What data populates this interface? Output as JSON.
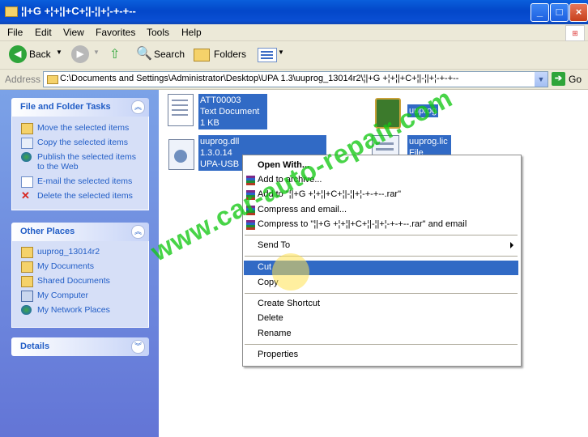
{
  "window": {
    "title": "¦|+G +¦+¦|+C+¦|-¦|+¦-+-+--"
  },
  "menubar": {
    "items": [
      "File",
      "Edit",
      "View",
      "Favorites",
      "Tools",
      "Help"
    ]
  },
  "toolbar": {
    "back": "Back",
    "search": "Search",
    "folders": "Folders"
  },
  "address": {
    "label": "Address",
    "value": "C:\\Documents and Settings\\Administrator\\Desktop\\UPA 1.3\\uuprog_13014r2\\¦|+G +¦+¦|+C+¦|-¦|+¦-+-+--",
    "go": "Go"
  },
  "taskpane": {
    "file_tasks": {
      "title": "File and Folder Tasks",
      "items": [
        "Move the selected items",
        "Copy the selected items",
        "Publish the selected items",
        "to the Web",
        "E-mail the selected items",
        "Delete the selected items"
      ]
    },
    "other_places": {
      "title": "Other Places",
      "items": [
        "uuprog_13014r2",
        "My Documents",
        "Shared Documents",
        "My Computer",
        "My Network Places"
      ]
    },
    "details": {
      "title": "Details"
    }
  },
  "files": [
    {
      "lines": [
        "ATT00003",
        "Text Document",
        "1 KB"
      ],
      "icon": "text-document-icon"
    },
    {
      "lines": [
        "uuprog"
      ],
      "icon": "chip-application-icon"
    },
    {
      "lines": [
        "uuprog.dll",
        "1.3.0.14",
        "UPA-USB"
      ],
      "icon": "dll-gear-icon"
    },
    {
      "lines": [
        "uuprog.lic",
        "File"
      ],
      "icon": "lic-file-icon"
    }
  ],
  "context_menu": {
    "items": [
      "Open With...",
      "Add to archive...",
      "Add to \"¦|+G +¦+¦|+C+¦|-¦|+¦-+-+--.rar\"",
      "Compress and email...",
      "Compress to \"¦|+G +¦+¦|+C+¦|-¦|+¦-+-+--.rar\" and email",
      "Send To",
      "Cut",
      "Copy",
      "Create Shortcut",
      "Delete",
      "Rename",
      "Properties"
    ],
    "highlighted": "Cut"
  },
  "watermark": "www.car-auto-repair.com",
  "colors": {
    "selection": "#316ac5",
    "titlebar": "#0347c9",
    "taskpane_link": "#215dc6",
    "watermark": "#14c814"
  }
}
